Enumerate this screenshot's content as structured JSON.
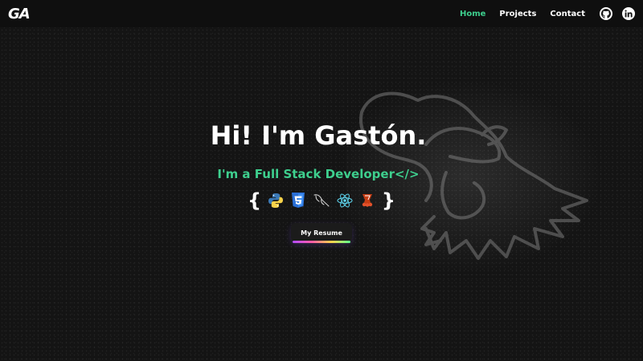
{
  "logo": "GA",
  "nav": {
    "links": [
      {
        "label": "Home",
        "active": true
      },
      {
        "label": "Projects",
        "active": false
      },
      {
        "label": "Contact",
        "active": false
      }
    ],
    "social": [
      "github-icon",
      "linkedin-icon"
    ]
  },
  "hero": {
    "title": "Hi! I'm Gastón.",
    "subtitle": "I'm a Full Stack Developer</>",
    "brace_open": "{",
    "brace_close": "}",
    "tech_icons": [
      "python-icon",
      "css3-icon",
      "mysql-icon",
      "react-icon",
      "jest-icon"
    ],
    "resume_label": "My Resume"
  },
  "colors": {
    "accent": "#3ecf8e",
    "background": "#141414",
    "navbar": "#0f0f0f"
  }
}
